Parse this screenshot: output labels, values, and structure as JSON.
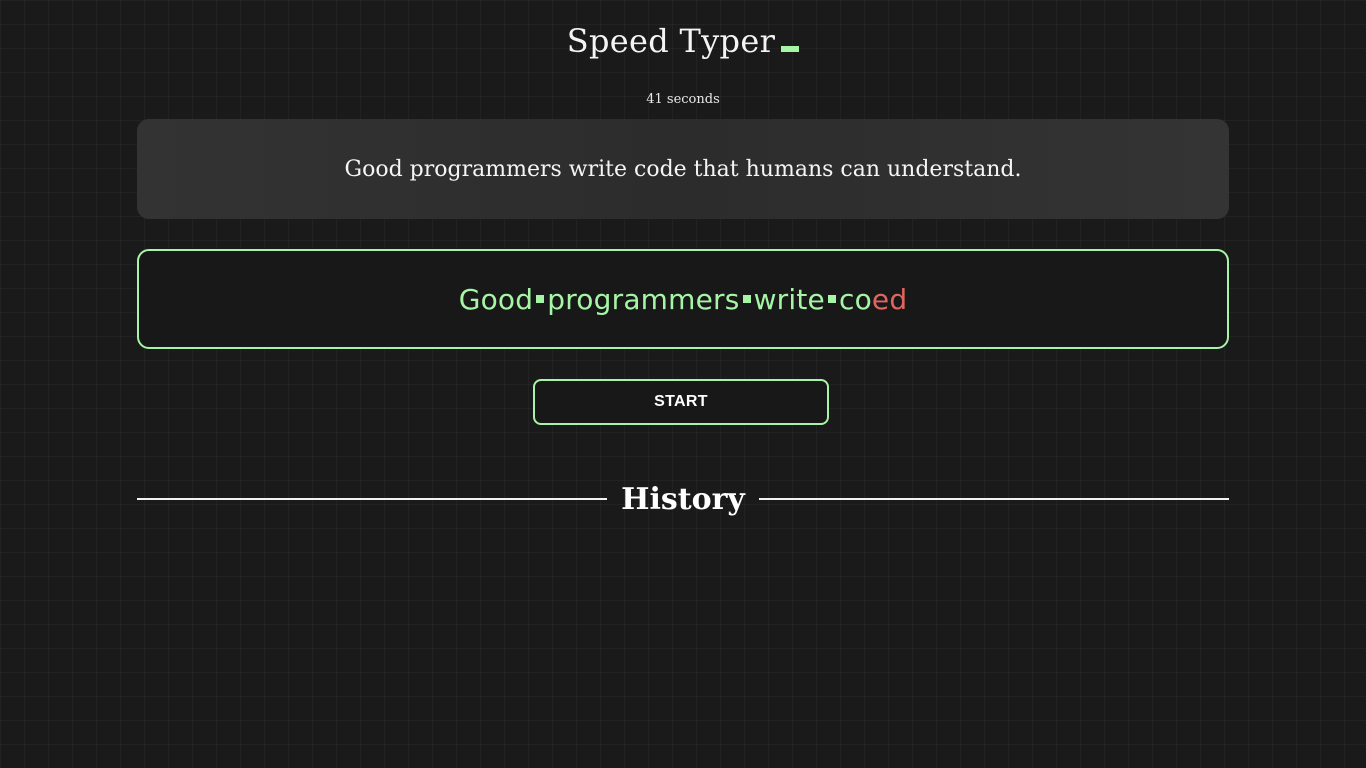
{
  "header": {
    "title": "Speed Typer"
  },
  "timer": {
    "text": "41 seconds"
  },
  "quote": {
    "text": "Good programmers write code that humans can understand."
  },
  "typing": {
    "correct_words": [
      "Good",
      "programmers",
      "write"
    ],
    "correct_partial": "co",
    "incorrect_partial": "ed"
  },
  "controls": {
    "start_label": "START"
  },
  "history": {
    "title": "History"
  },
  "colors": {
    "accent": "#a6f5a6",
    "error": "#e0655f",
    "background": "#1a1a1a"
  }
}
